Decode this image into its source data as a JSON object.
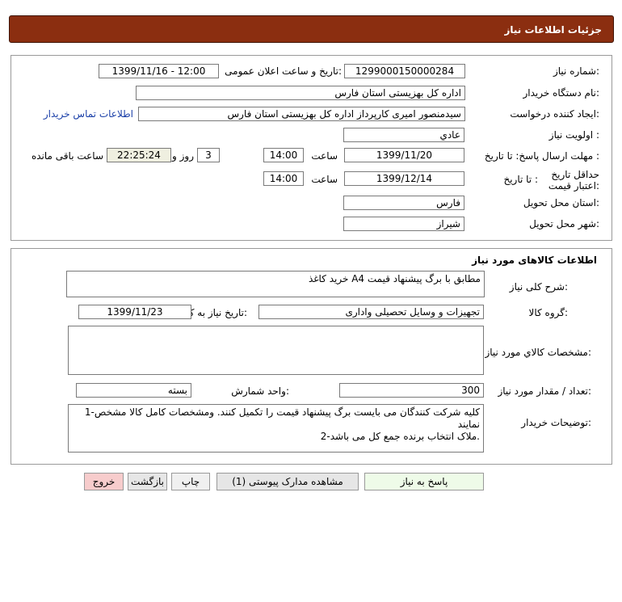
{
  "header": {
    "title": "جزئیات اطلاعات نیاز"
  },
  "info": {
    "need_number_label": "شماره نیاز:",
    "need_number": "1299000150000284",
    "announce_label": "تاریخ و ساعت اعلان عمومی:",
    "announce_value": "1399/11/16 - 12:00",
    "buyer_org_label": "نام دستگاه خریدار:",
    "buyer_org": "اداره کل بهزیستی استان فارس",
    "creator_label": "ایجاد کننده درخواست:",
    "creator": "سیدمنصور امیری کارپرداز اداره کل بهزیستی استان فارس",
    "contact_link": "اطلاعات تماس خریدار",
    "priority_label": "اولویت نیاز :",
    "priority": "عادي",
    "deadline_label": "مهلت ارسال پاسخ: تا تاریخ :",
    "deadline_date": "1399/11/20",
    "time_label": "ساعت",
    "deadline_time": "14:00",
    "days_value": "3",
    "days_label": "روز و",
    "remaining_value": "22:25:24",
    "remaining_label": "ساعت باقی مانده",
    "validity_label": "حداقل تاریخ اعتبار قیمت:",
    "validity_to_label": "تا تاریخ :",
    "validity_date": "1399/12/14",
    "validity_time_label": "ساعت",
    "validity_time": "14:00",
    "province_label": "استان محل تحویل:",
    "province": "فارس",
    "city_label": "شهر محل تحویل:",
    "city": "شیراز"
  },
  "goods": {
    "section_title": "اطلاعات کالاهای مورد نیاز",
    "description_label": "شرح کلی نیاز:",
    "description": "خرید کاغذ A4  مطابق با برگ پیشنهاد قیمت",
    "group_label": "گروه کالا:",
    "group": "تجهیزات و وسایل تحصیلی واداری",
    "need_date_label": "تاریخ نیاز به کالا:",
    "need_date": "1399/11/23",
    "specs_label": "مشخصات کالاي مورد نیاز:",
    "specs": "",
    "qty_label": "تعداد / مقدار مورد نیاز:",
    "qty": "300",
    "unit_label": "واحد شمارش:",
    "unit": "بسته",
    "notes_label": "توضیحات خریدار:",
    "notes_line1": "1-کلیه شرکت کنندگان می بایست برگ پیشنهاد قیمت را تکمیل کنند. ومشخصات کامل کالا مشخص نمایند",
    "notes_line2": "2-ملاک انتخاب برنده جمع کل می باشد."
  },
  "buttons": {
    "reply": "پاسخ به نیاز",
    "attachments": "مشاهده مدارک پیوستی (1)",
    "print": "چاپ",
    "back": "بازگشت",
    "exit": "خروج"
  }
}
